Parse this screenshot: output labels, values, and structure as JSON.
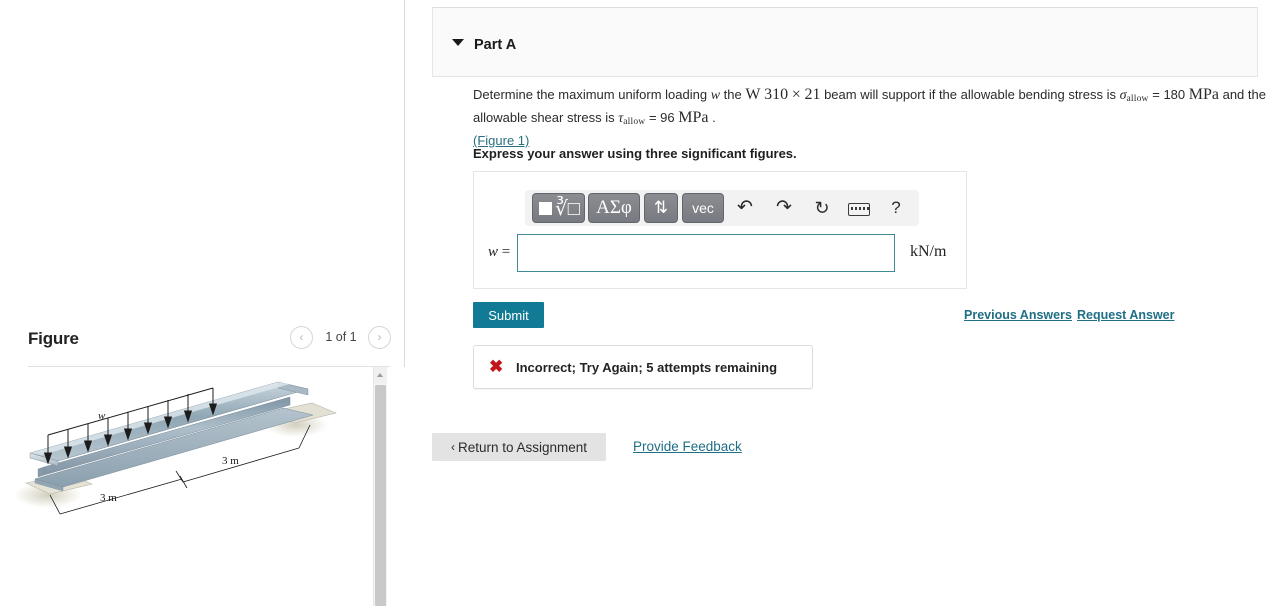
{
  "figure_panel": {
    "title": "Figure",
    "pager": {
      "label": "1 of 1",
      "prev_glyph": "‹",
      "next_glyph": "›"
    },
    "diagram": {
      "load_label": "w",
      "dim_left": "3 m",
      "dim_right": "3 m"
    }
  },
  "part": {
    "title": "Part A",
    "question": {
      "t1": "Determine the maximum uniform loading ",
      "var_w": "w",
      "t2": " the ",
      "beam_designation": "W 310",
      "times": "×",
      "beam_number": "21",
      "t3": " beam will support if the allowable bending stress is ",
      "sigma": "σ",
      "sigma_sub": "allow",
      "t4": " = 180 ",
      "unit_mpa_1": "MPa",
      "t5": " and the allowable shear stress is ",
      "tau": "τ",
      "tau_sub": "allow",
      "t6": " = 96 ",
      "unit_mpa_2": "MPa",
      "t7": " ."
    },
    "figure_link": "(Figure 1)",
    "express_instruction": "Express your answer using three significant figures."
  },
  "toolbar": {
    "template_label": "template-sqrt",
    "radical_glyph": "∛□",
    "greek_label": "ΑΣφ",
    "arrows_label": "⇅",
    "vec_label": "vec",
    "undo_glyph": "↶",
    "redo_glyph": "↷",
    "reset_glyph": "↻",
    "keyboard_label": "keyboard",
    "help_label": "?"
  },
  "answer": {
    "variable_label": "w =",
    "value": "",
    "placeholder": "",
    "units": "kN/m"
  },
  "actions": {
    "submit_label": "Submit",
    "previous_answers_label": "Previous Answers",
    "request_answer_label": "Request Answer"
  },
  "feedback": {
    "icon": "✖",
    "message": "Incorrect; Try Again; 5 attempts remaining",
    "color": "#c0161c"
  },
  "footer": {
    "return_chevron": "‹",
    "return_label": "Return to Assignment",
    "provide_feedback_label": "Provide Feedback"
  },
  "colors": {
    "accent_teal": "#117a94",
    "link_teal": "#1f6f86",
    "panel_bg": "#fafafa",
    "error_red": "#c0161c"
  }
}
